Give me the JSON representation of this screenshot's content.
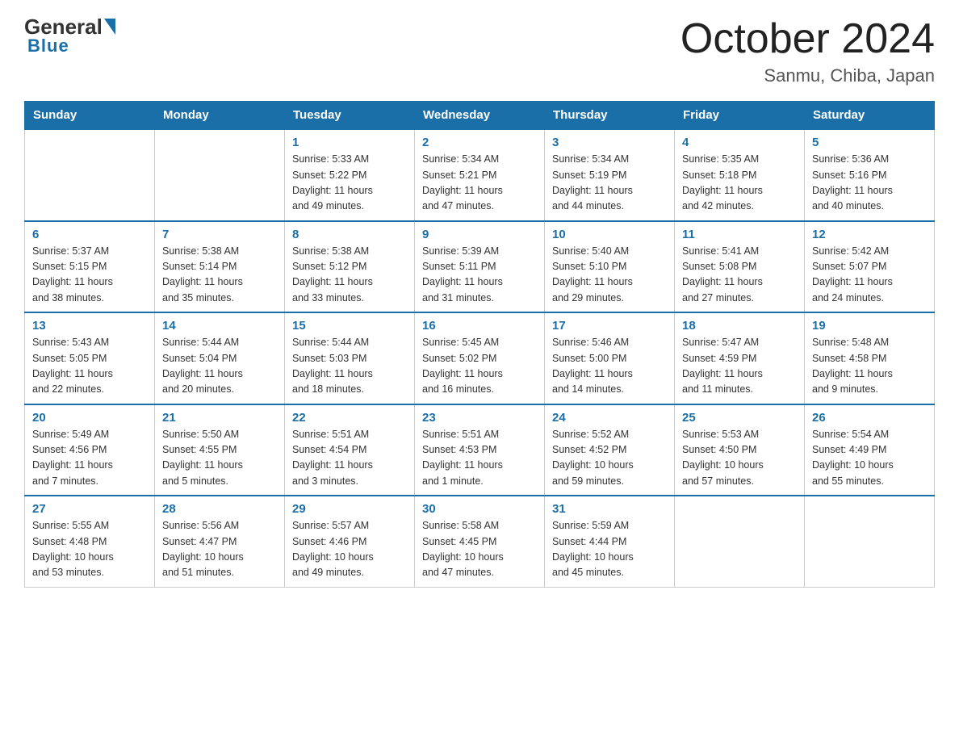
{
  "header": {
    "logo_general": "General",
    "logo_blue": "Blue",
    "title": "October 2024",
    "subtitle": "Sanmu, Chiba, Japan"
  },
  "days_of_week": [
    "Sunday",
    "Monday",
    "Tuesday",
    "Wednesday",
    "Thursday",
    "Friday",
    "Saturday"
  ],
  "weeks": [
    [
      {
        "day": "",
        "info": ""
      },
      {
        "day": "",
        "info": ""
      },
      {
        "day": "1",
        "info": "Sunrise: 5:33 AM\nSunset: 5:22 PM\nDaylight: 11 hours\nand 49 minutes."
      },
      {
        "day": "2",
        "info": "Sunrise: 5:34 AM\nSunset: 5:21 PM\nDaylight: 11 hours\nand 47 minutes."
      },
      {
        "day": "3",
        "info": "Sunrise: 5:34 AM\nSunset: 5:19 PM\nDaylight: 11 hours\nand 44 minutes."
      },
      {
        "day": "4",
        "info": "Sunrise: 5:35 AM\nSunset: 5:18 PM\nDaylight: 11 hours\nand 42 minutes."
      },
      {
        "day": "5",
        "info": "Sunrise: 5:36 AM\nSunset: 5:16 PM\nDaylight: 11 hours\nand 40 minutes."
      }
    ],
    [
      {
        "day": "6",
        "info": "Sunrise: 5:37 AM\nSunset: 5:15 PM\nDaylight: 11 hours\nand 38 minutes."
      },
      {
        "day": "7",
        "info": "Sunrise: 5:38 AM\nSunset: 5:14 PM\nDaylight: 11 hours\nand 35 minutes."
      },
      {
        "day": "8",
        "info": "Sunrise: 5:38 AM\nSunset: 5:12 PM\nDaylight: 11 hours\nand 33 minutes."
      },
      {
        "day": "9",
        "info": "Sunrise: 5:39 AM\nSunset: 5:11 PM\nDaylight: 11 hours\nand 31 minutes."
      },
      {
        "day": "10",
        "info": "Sunrise: 5:40 AM\nSunset: 5:10 PM\nDaylight: 11 hours\nand 29 minutes."
      },
      {
        "day": "11",
        "info": "Sunrise: 5:41 AM\nSunset: 5:08 PM\nDaylight: 11 hours\nand 27 minutes."
      },
      {
        "day": "12",
        "info": "Sunrise: 5:42 AM\nSunset: 5:07 PM\nDaylight: 11 hours\nand 24 minutes."
      }
    ],
    [
      {
        "day": "13",
        "info": "Sunrise: 5:43 AM\nSunset: 5:05 PM\nDaylight: 11 hours\nand 22 minutes."
      },
      {
        "day": "14",
        "info": "Sunrise: 5:44 AM\nSunset: 5:04 PM\nDaylight: 11 hours\nand 20 minutes."
      },
      {
        "day": "15",
        "info": "Sunrise: 5:44 AM\nSunset: 5:03 PM\nDaylight: 11 hours\nand 18 minutes."
      },
      {
        "day": "16",
        "info": "Sunrise: 5:45 AM\nSunset: 5:02 PM\nDaylight: 11 hours\nand 16 minutes."
      },
      {
        "day": "17",
        "info": "Sunrise: 5:46 AM\nSunset: 5:00 PM\nDaylight: 11 hours\nand 14 minutes."
      },
      {
        "day": "18",
        "info": "Sunrise: 5:47 AM\nSunset: 4:59 PM\nDaylight: 11 hours\nand 11 minutes."
      },
      {
        "day": "19",
        "info": "Sunrise: 5:48 AM\nSunset: 4:58 PM\nDaylight: 11 hours\nand 9 minutes."
      }
    ],
    [
      {
        "day": "20",
        "info": "Sunrise: 5:49 AM\nSunset: 4:56 PM\nDaylight: 11 hours\nand 7 minutes."
      },
      {
        "day": "21",
        "info": "Sunrise: 5:50 AM\nSunset: 4:55 PM\nDaylight: 11 hours\nand 5 minutes."
      },
      {
        "day": "22",
        "info": "Sunrise: 5:51 AM\nSunset: 4:54 PM\nDaylight: 11 hours\nand 3 minutes."
      },
      {
        "day": "23",
        "info": "Sunrise: 5:51 AM\nSunset: 4:53 PM\nDaylight: 11 hours\nand 1 minute."
      },
      {
        "day": "24",
        "info": "Sunrise: 5:52 AM\nSunset: 4:52 PM\nDaylight: 10 hours\nand 59 minutes."
      },
      {
        "day": "25",
        "info": "Sunrise: 5:53 AM\nSunset: 4:50 PM\nDaylight: 10 hours\nand 57 minutes."
      },
      {
        "day": "26",
        "info": "Sunrise: 5:54 AM\nSunset: 4:49 PM\nDaylight: 10 hours\nand 55 minutes."
      }
    ],
    [
      {
        "day": "27",
        "info": "Sunrise: 5:55 AM\nSunset: 4:48 PM\nDaylight: 10 hours\nand 53 minutes."
      },
      {
        "day": "28",
        "info": "Sunrise: 5:56 AM\nSunset: 4:47 PM\nDaylight: 10 hours\nand 51 minutes."
      },
      {
        "day": "29",
        "info": "Sunrise: 5:57 AM\nSunset: 4:46 PM\nDaylight: 10 hours\nand 49 minutes."
      },
      {
        "day": "30",
        "info": "Sunrise: 5:58 AM\nSunset: 4:45 PM\nDaylight: 10 hours\nand 47 minutes."
      },
      {
        "day": "31",
        "info": "Sunrise: 5:59 AM\nSunset: 4:44 PM\nDaylight: 10 hours\nand 45 minutes."
      },
      {
        "day": "",
        "info": ""
      },
      {
        "day": "",
        "info": ""
      }
    ]
  ]
}
